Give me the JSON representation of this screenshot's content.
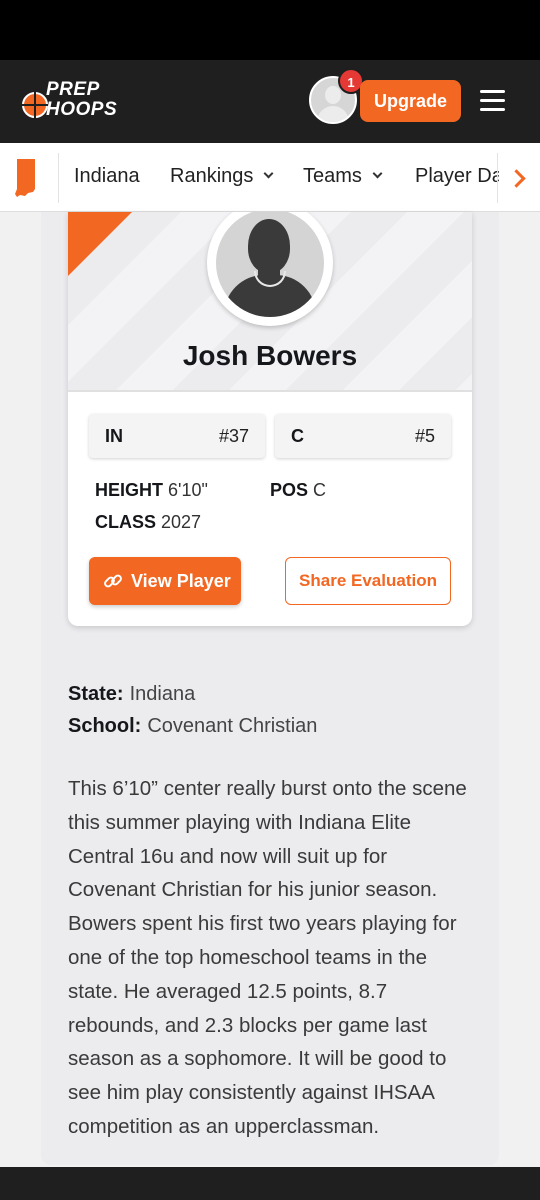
{
  "header": {
    "logo_line1": "PREP",
    "logo_line2": "HOOPS",
    "notification_count": "1",
    "upgrade_label": "Upgrade"
  },
  "subnav": {
    "items": [
      "Indiana",
      "Rankings",
      "Teams",
      "Player Da"
    ]
  },
  "player": {
    "name": "Josh Bowers",
    "rank_state": "IN",
    "rank_state_value": "#37",
    "rank_pos": "C",
    "rank_pos_value": "#5",
    "height_label": "HEIGHT",
    "height": "6'10\"",
    "pos_label": "POS",
    "pos": "C",
    "class_label": "CLASS",
    "class_year": "2027",
    "view_label": "View Player",
    "share_label": "Share Evaluation"
  },
  "details": {
    "state_label": "State:",
    "state": "Indiana",
    "school_label": "School:",
    "school": "Covenant Christian",
    "description": "This 6’10” center really burst onto the scene this summer playing with Indiana Elite Central 16u and now will suit up for Covenant Christian for his junior season. Bowers spent his first two years playing for one of the top homeschool teams in the state. He averaged 12.5 points, 8.7 rebounds, and 2.3 blocks per game last season as a sophomore. It will be good to see him play consistently against IHSAA competition as an upperclassman."
  },
  "colors": {
    "accent": "#f26722",
    "header_bg": "#1f1f1f",
    "badge": "#e53935"
  }
}
